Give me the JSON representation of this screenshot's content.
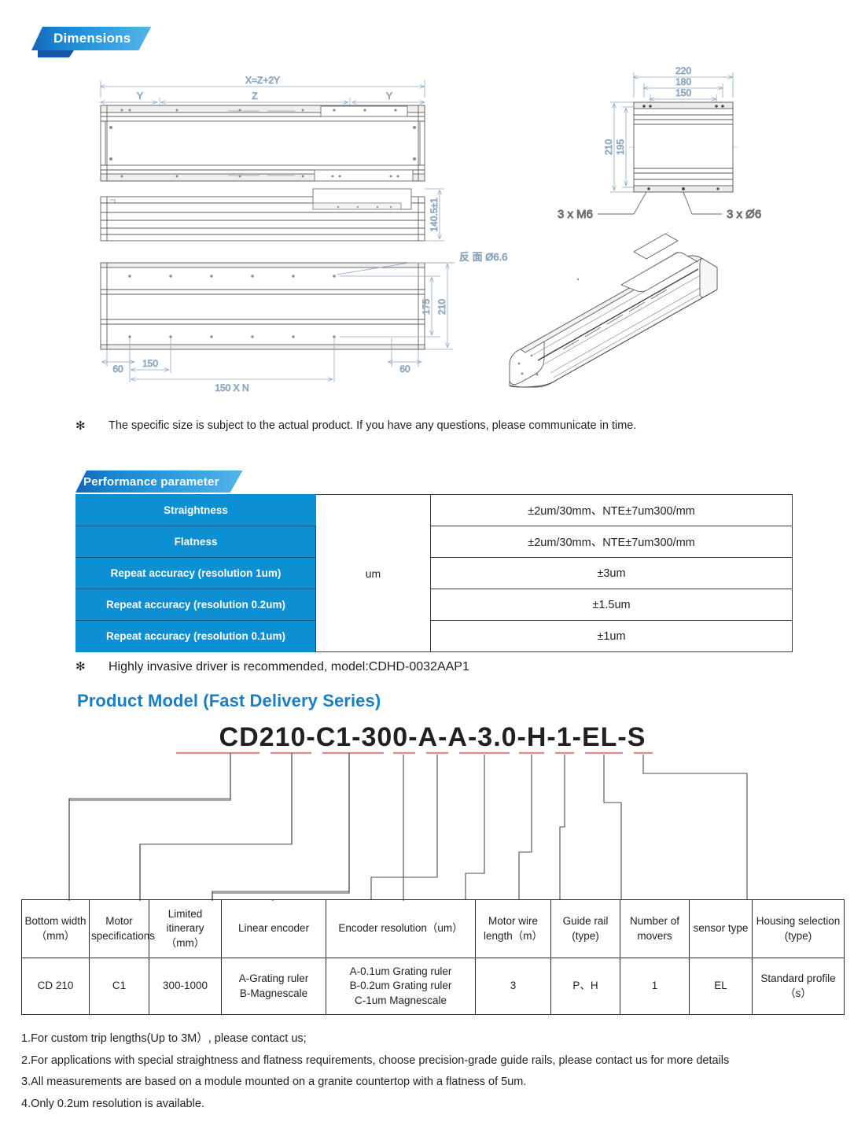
{
  "sections": {
    "dimensions_banner": "Dimensions",
    "performance_banner": "Performance parameter",
    "product_model_heading": "Product Model (Fast Delivery Series)"
  },
  "colors": {
    "banner_blue_dark": "#1565b8",
    "banner_blue_light": "#55b4e8",
    "table_header_blue": "#0d8fd4",
    "heading_blue": "#1a7ec4",
    "dimension_line": "#8fa8c0",
    "underline_red": "#e48b8b"
  },
  "drawing": {
    "top_view": {
      "overall": "X=Z+2Y",
      "left_segment": "Y",
      "middle_segment": "Z",
      "right_segment": "Y"
    },
    "side_view": {
      "height": "140.5±1"
    },
    "bottom_view": {
      "callout": "反面 Ø6.6",
      "inner_height": "175",
      "outer_height": "210",
      "edge_left": "60",
      "pitch": "150",
      "edge_right": "60",
      "total_pitch": "150 X N"
    },
    "end_view": {
      "width_outer": "220",
      "width_mid": "180",
      "width_inner": "150",
      "height_outer": "210",
      "height_inner": "195",
      "thread_callout": "3 x M6",
      "hole_callout": "3 x Ø6"
    }
  },
  "notes": {
    "size_note": "The specific size is subject to the actual product. If you have any questions, please communicate in time.",
    "driver_note": "Highly invasive driver is recommended, model:CDHD-0032AAP1",
    "star": "✻"
  },
  "performance_table": {
    "unit": "um",
    "rows": [
      {
        "label": "Straightness",
        "value": "±2um/30mm、NTE±7um300/mm"
      },
      {
        "label": "Flatness",
        "value": "±2um/30mm、NTE±7um300/mm"
      },
      {
        "label": "Repeat accuracy (resolution 1um)",
        "value": "±3um"
      },
      {
        "label": "Repeat accuracy (resolution 0.2um)",
        "value": "±1.5um"
      },
      {
        "label": "Repeat accuracy (resolution 0.1um)",
        "value": "±1um"
      }
    ]
  },
  "model_code": {
    "full": "CD210-C1-300-A-A-3.0-H-1-EL-S",
    "segments": [
      "CD210",
      "C1",
      "300",
      "A",
      "A",
      "3.0",
      "H",
      "1",
      "EL",
      "S"
    ]
  },
  "spec_table": {
    "headers": [
      "Bottom width（mm）",
      "Motor specifications",
      "Limited itinerary（mm）",
      "Linear encoder",
      "Encoder resolution（um）",
      "Motor wire length（m）",
      "Guide rail (type)",
      "Number of movers",
      "sensor type",
      "Housing selection (type)"
    ],
    "values": [
      "CD 210",
      "C1",
      "300-1000",
      "A-Grating ruler\nB-Magnescale",
      "A-0.1um Grating ruler\nB-0.2um Grating ruler\nC-1um Magnescale",
      "3",
      "P、H",
      "1",
      "EL",
      "Standard profile（s）"
    ]
  },
  "footnotes": [
    "1.For custom trip lengths(Up to 3M）, please contact us;",
    "2.For applications with special straightness and flatness requirements, choose precision-grade guide rails, please contact us for more details",
    "3.All measurements are based on a module mounted on a granite countertop with a flatness of 5um.",
    "4.Only 0.2um resolution is available."
  ]
}
